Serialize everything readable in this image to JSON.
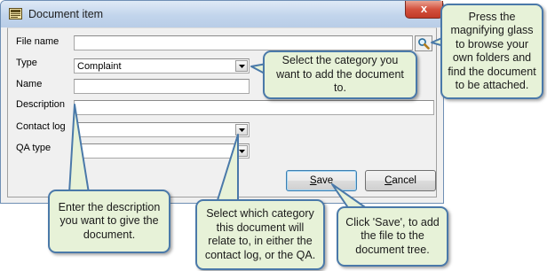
{
  "window": {
    "title": "Document item",
    "close_label": "x"
  },
  "form": {
    "file_name_label": "File name",
    "file_name_value": "",
    "type_label": "Type",
    "type_value": "Complaint",
    "name_label": "Name",
    "name_value": "",
    "description_label": "Description",
    "description_value": "",
    "contact_log_label": "Contact log",
    "contact_log_value": "",
    "qa_type_label": "QA type",
    "qa_type_value": ""
  },
  "buttons": {
    "save_prefix": "S",
    "save_rest": "ave",
    "cancel_prefix": "C",
    "cancel_rest": "ancel"
  },
  "callouts": {
    "browse": "Press the magnifying glass to browse your own folders and find the document to be attached.",
    "type": "Select the category you want to add the document to.",
    "description": "Enter the description you want to give the document.",
    "category": "Select which category this document will relate to, in either the contact log, or the QA.",
    "save": "Click 'Save', to add the file to the document tree."
  },
  "colors": {
    "callout_fill": "#e7f2d8",
    "callout_border": "#4a79a9",
    "title_bar": "#c2d5ec",
    "close_button": "#d3513e"
  },
  "icons": {
    "app": "document-app-icon",
    "browse": "magnifying-glass-icon",
    "dropdown": "chevron-down-icon"
  }
}
